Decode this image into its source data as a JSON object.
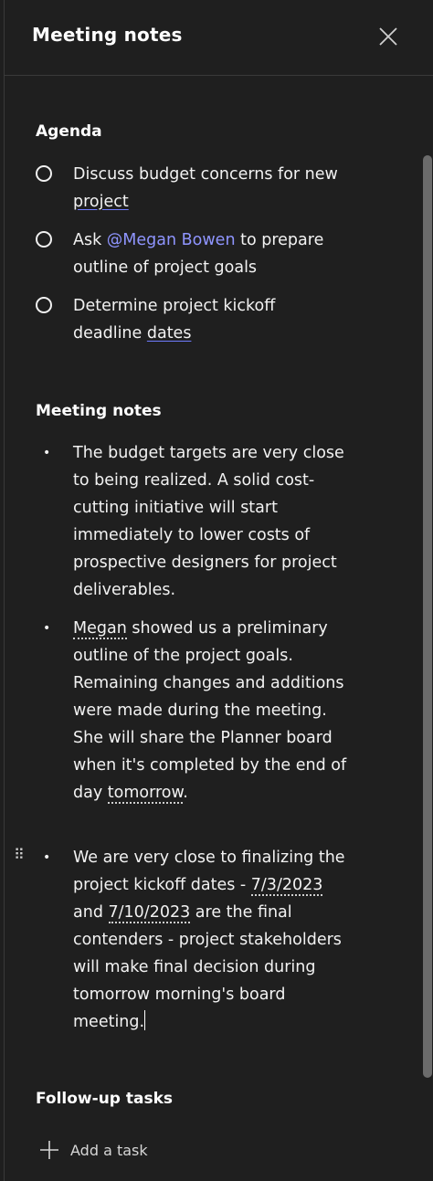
{
  "header": {
    "title": "Meeting notes",
    "close_icon": "close-icon"
  },
  "agenda": {
    "title": "Agenda",
    "items": [
      {
        "line1": "Discuss budget concerns for new",
        "line2": "project"
      },
      {
        "pre": "Ask ",
        "mention": "@Megan Bowen",
        "post": " to prepare",
        "line2": "outline of project goals"
      },
      {
        "line1": "Determine project kickoff",
        "line2_pre": "deadline ",
        "line2_word": "dates"
      }
    ]
  },
  "notes": {
    "title": "Meeting notes",
    "bullet_glyph": "•",
    "items": [
      {
        "text": "The budget targets are very close to being realized. A solid cost-cutting initiative will start immediately to lower costs of prospective designers for project deliverables."
      },
      {
        "name": "Megan",
        "mid": " showed us a preliminary outline of the project goals. Remaining changes and additions were made during the meeting. She will share the Planner board when it's completed by the end of day ",
        "date": "tomorrow",
        "end": "."
      },
      {
        "pre": "We are very close to finalizing the project kickoff dates - ",
        "date1": "7/3/2023",
        "and": " and ",
        "date2": "7/10/2023",
        "post": " are the final contenders - project stakeholders will make final decision during tomorrow morning's board meeting."
      }
    ]
  },
  "followup": {
    "title": "Follow-up tasks",
    "add_label": "Add a task"
  },
  "colors": {
    "background": "#1f1f1f",
    "mention": "#8f95ff",
    "text": "#f2f2f2"
  }
}
